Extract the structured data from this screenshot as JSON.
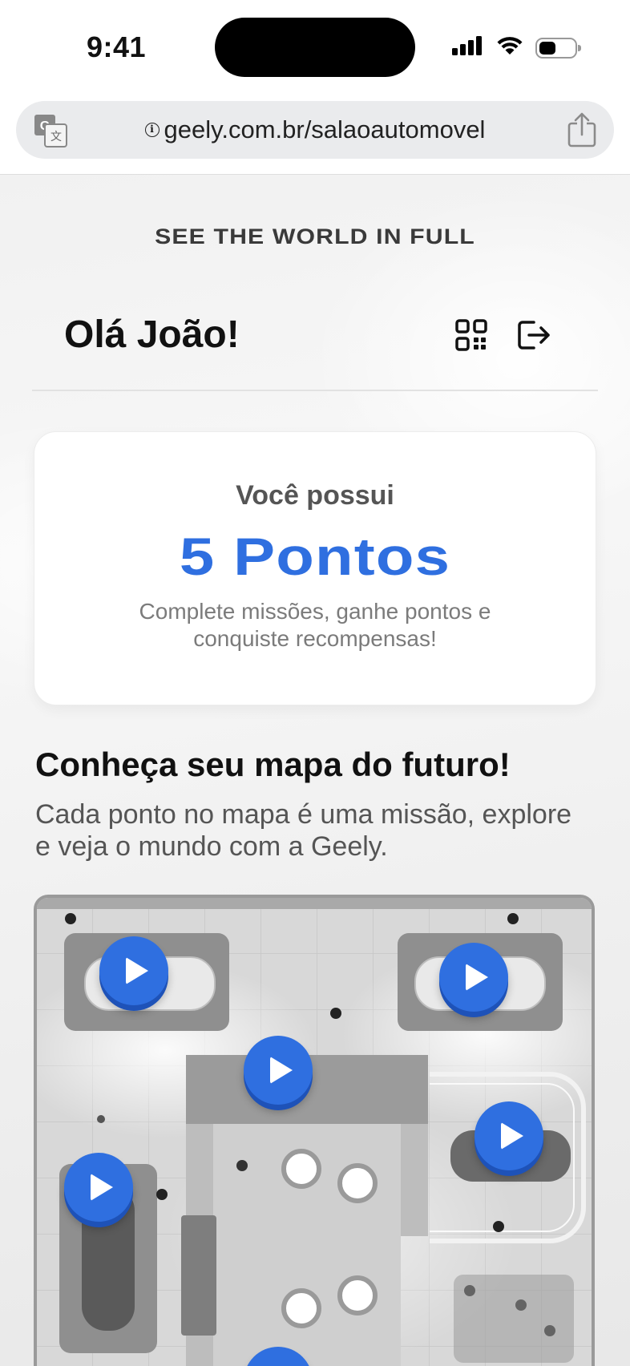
{
  "status_bar": {
    "time": "9:41"
  },
  "browser": {
    "url": "geely.com.br/salaoautomovel",
    "url_info_glyph": "i",
    "translate_icon": "translate-icon",
    "share_icon": "share-icon"
  },
  "page": {
    "tagline": "SEE THE WORLD IN FULL",
    "greeting": "Olá João!",
    "qr_icon": "qr-code-icon",
    "logout_icon": "logout-icon"
  },
  "points_card": {
    "label": "Você possui",
    "value": "5 Pontos",
    "description": "Complete missões, ganhe pontos e conquiste recompensas!"
  },
  "map_section": {
    "title": "Conheça seu mapa do futuro!",
    "description": "Cada ponto no mapa é uma missão, explore    e veja o mundo com a Geely.",
    "missions": [
      {
        "id": "mission-1",
        "icon": "play-icon"
      },
      {
        "id": "mission-2",
        "icon": "play-icon"
      },
      {
        "id": "mission-3",
        "icon": "play-icon"
      },
      {
        "id": "mission-4",
        "icon": "play-icon"
      },
      {
        "id": "mission-5",
        "icon": "play-icon"
      },
      {
        "id": "mission-6",
        "icon": "play-icon"
      }
    ]
  },
  "colors": {
    "accent": "#2f6fe0",
    "accent_shadow": "#1e52b8",
    "text_primary": "#111111",
    "text_secondary": "#555555"
  }
}
